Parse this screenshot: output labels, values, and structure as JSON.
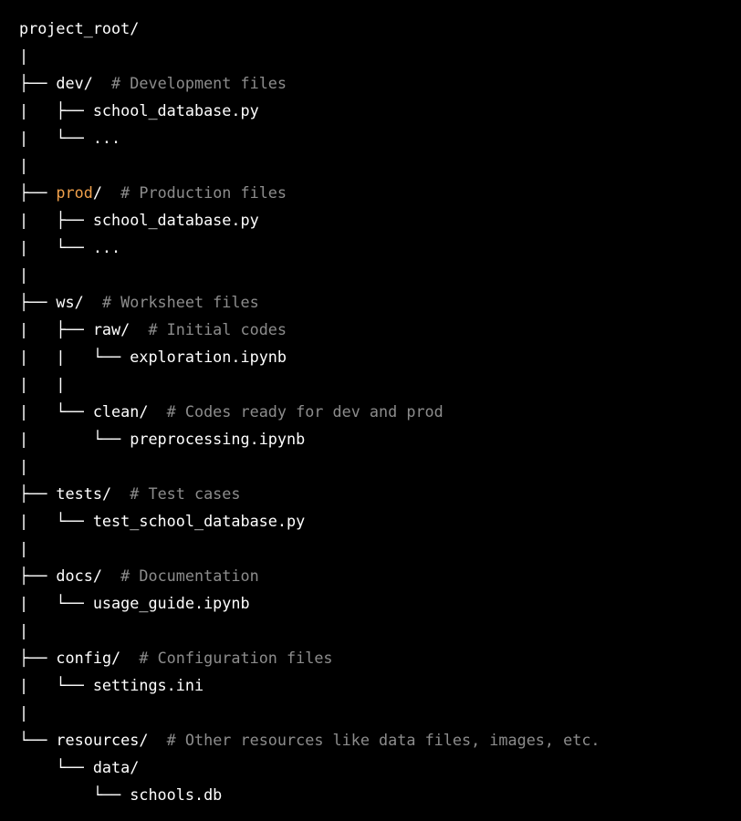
{
  "colors": {
    "background": "#000000",
    "text": "#ffffff",
    "comment": "#8c8c8c",
    "highlight": "#f0a04b"
  },
  "lines": [
    {
      "prefix": "",
      "name": "project_root/",
      "comment": ""
    },
    {
      "prefix": "|",
      "name": "",
      "comment": ""
    },
    {
      "prefix": "├── ",
      "name": "dev/",
      "comment": "  # Development files"
    },
    {
      "prefix": "|   ├── ",
      "name": "school_database.py",
      "comment": ""
    },
    {
      "prefix": "|   └── ",
      "name": "...",
      "comment": ""
    },
    {
      "prefix": "|",
      "name": "",
      "comment": ""
    },
    {
      "prefix": "├── ",
      "name": "prod",
      "suffix": "/",
      "highlight": true,
      "comment": "  # Production files"
    },
    {
      "prefix": "|   ├── ",
      "name": "school_database.py",
      "comment": ""
    },
    {
      "prefix": "|   └── ",
      "name": "...",
      "comment": ""
    },
    {
      "prefix": "|",
      "name": "",
      "comment": ""
    },
    {
      "prefix": "├── ",
      "name": "ws/",
      "comment": "  # Worksheet files"
    },
    {
      "prefix": "|   ├── ",
      "name": "raw/",
      "comment": "  # Initial codes"
    },
    {
      "prefix": "|   |   └── ",
      "name": "exploration.ipynb",
      "comment": ""
    },
    {
      "prefix": "|   |",
      "name": "",
      "comment": ""
    },
    {
      "prefix": "|   └── ",
      "name": "clean/",
      "comment": "  # Codes ready for dev and prod"
    },
    {
      "prefix": "|       └── ",
      "name": "preprocessing.ipynb",
      "comment": ""
    },
    {
      "prefix": "|",
      "name": "",
      "comment": ""
    },
    {
      "prefix": "├── ",
      "name": "tests/",
      "comment": "  # Test cases"
    },
    {
      "prefix": "|   └── ",
      "name": "test_school_database.py",
      "comment": ""
    },
    {
      "prefix": "|",
      "name": "",
      "comment": ""
    },
    {
      "prefix": "├── ",
      "name": "docs/",
      "comment": "  # Documentation"
    },
    {
      "prefix": "|   └── ",
      "name": "usage_guide.ipynb",
      "comment": ""
    },
    {
      "prefix": "|",
      "name": "",
      "comment": ""
    },
    {
      "prefix": "├── ",
      "name": "config/",
      "comment": "  # Configuration files"
    },
    {
      "prefix": "|   └── ",
      "name": "settings.ini",
      "comment": ""
    },
    {
      "prefix": "|",
      "name": "",
      "comment": ""
    },
    {
      "prefix": "└── ",
      "name": "resources/",
      "comment": "  # Other resources like data files, images, etc."
    },
    {
      "prefix": "    └── ",
      "name": "data/",
      "comment": ""
    },
    {
      "prefix": "        └── ",
      "name": "schools.db",
      "comment": ""
    }
  ]
}
